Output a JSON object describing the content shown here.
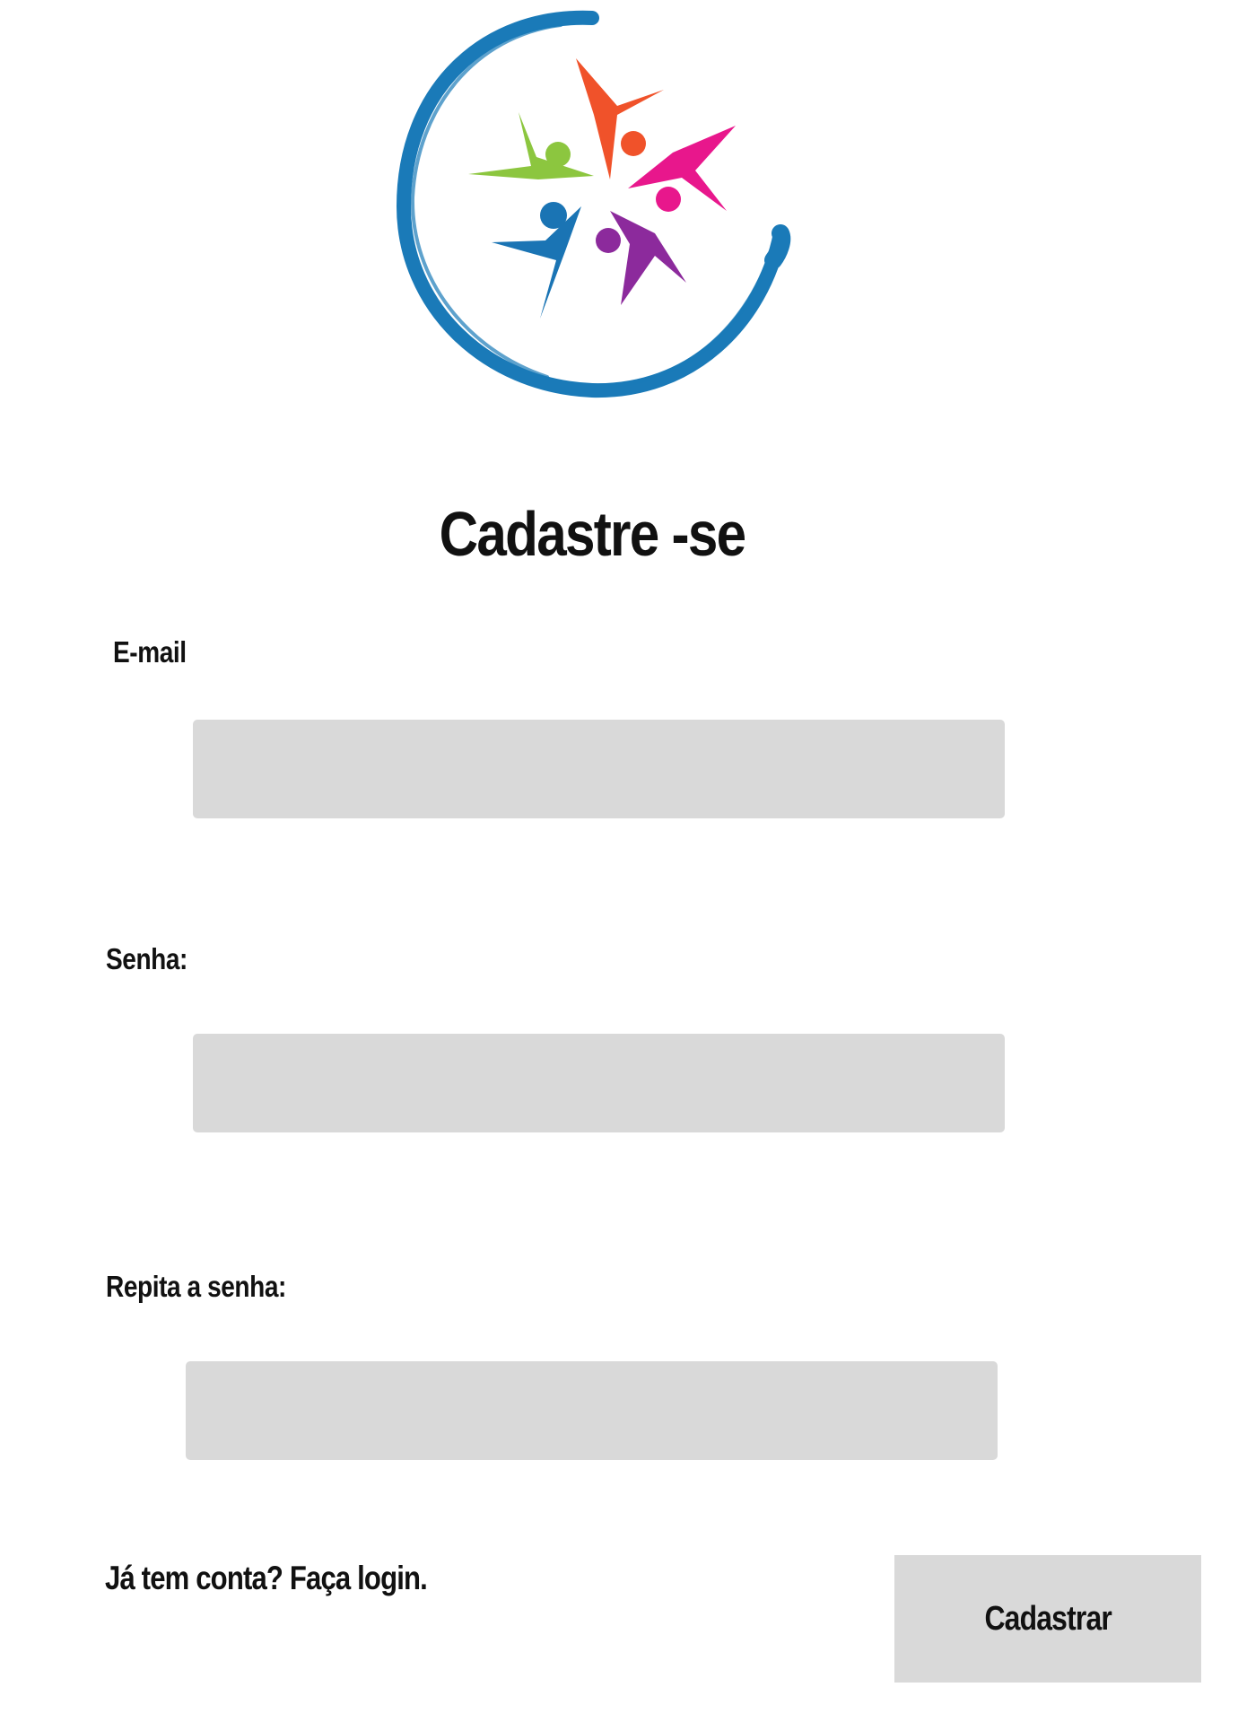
{
  "logo": {
    "icon": "people-circle-logo-icon",
    "colors": {
      "ring": "#1a7ab8",
      "orange": "#f0522a",
      "pink": "#e8178c",
      "purple": "#8c2a9c",
      "blue": "#1a74b4",
      "green": "#8cc63f"
    }
  },
  "page": {
    "title": "Cadastre -se"
  },
  "form": {
    "email": {
      "label": "E-mail",
      "value": "",
      "placeholder": ""
    },
    "password": {
      "label": "Senha:",
      "value": "",
      "placeholder": ""
    },
    "repeat_password": {
      "label": "Repita a senha:",
      "value": "",
      "placeholder": ""
    },
    "login_link": "Já tem conta? Faça login.",
    "submit_label": "Cadastrar"
  },
  "colors": {
    "field_background": "#d9d9d9",
    "button_background": "#d9d9d9",
    "text": "#111111"
  }
}
